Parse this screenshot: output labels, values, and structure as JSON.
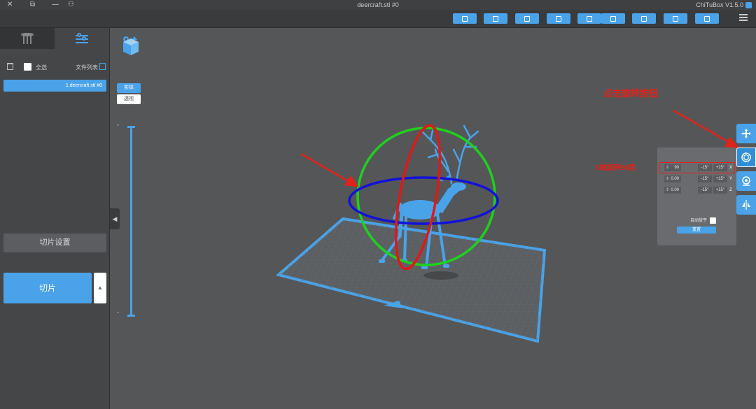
{
  "window": {
    "title": "deercraft.stl #0",
    "app_name": "ChiTuBox V1.5.0"
  },
  "left_panel": {
    "file_list_label": "文件列表",
    "select_all_label": "全选",
    "files": [
      {
        "name": "1.deercraft.stl #0"
      }
    ],
    "slice_settings_label": "切片设置",
    "slice_button_label": "切片"
  },
  "viewport": {
    "view_modes": {
      "solid": "实体",
      "transparent": "透视"
    },
    "layer_slider": {
      "top_symbol": "ˇ",
      "bottom_symbol": "ˆ"
    }
  },
  "rotate_panel": {
    "rows": [
      {
        "axis": "X",
        "value": "90",
        "minus": "-15°",
        "plus": "+15°"
      },
      {
        "axis": "Y",
        "value": "0.00",
        "minus": "-15°",
        "plus": "+15°"
      },
      {
        "axis": "Z",
        "value": "0.00",
        "minus": "-15°",
        "plus": "+15°"
      }
    ],
    "lay_flat_label": "自动放平",
    "reset_label": "重置"
  },
  "annotations": {
    "rotate_tool": "点击旋转按钮",
    "x_axis": "X轴旋转90度"
  },
  "colors": {
    "accent": "#4aa3e8",
    "annotation": "#e2231a",
    "ring_green": "#1fd01f",
    "ring_blue": "#1212d8",
    "ring_red": "#e01818"
  }
}
